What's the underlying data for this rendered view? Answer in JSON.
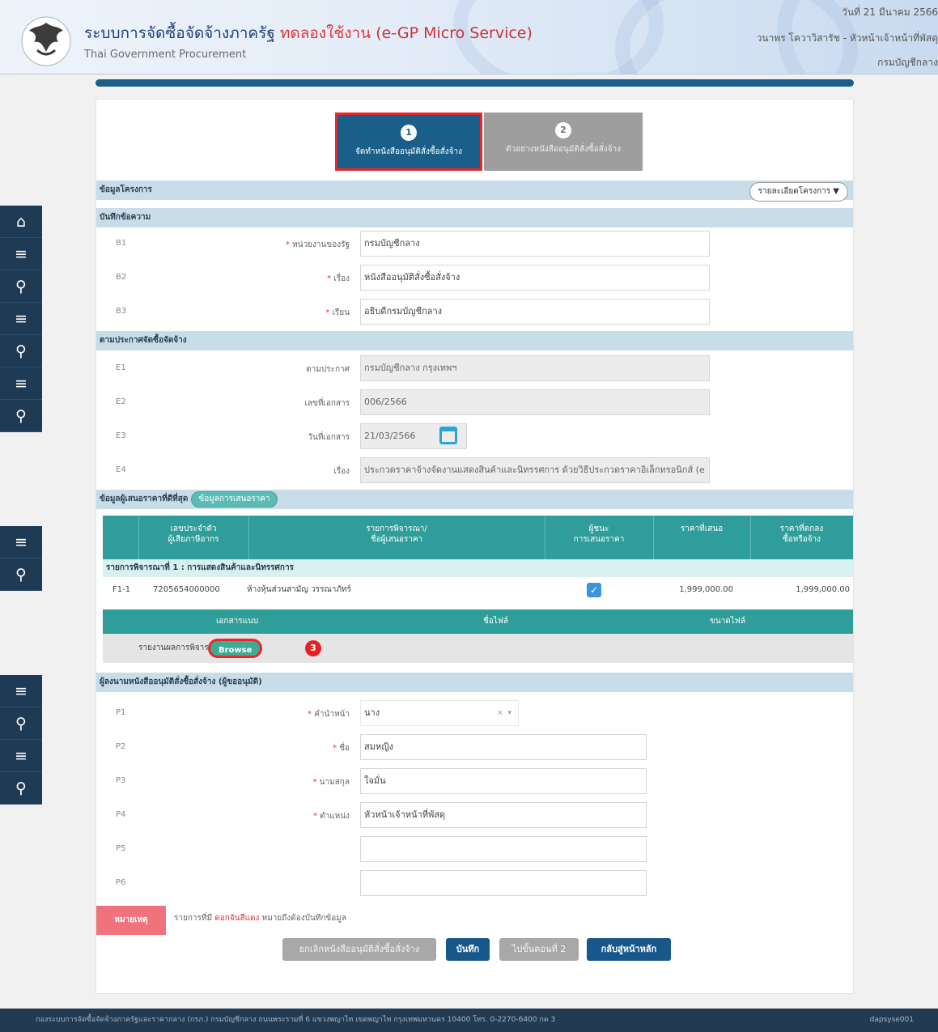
{
  "header": {
    "title_prefix": "ระบบการจัดซื้อจัดจ้างภาครัฐ ",
    "title_trial": "ทดลองใช้งาน",
    "title_suffix": " (e-GP Micro Service)",
    "subtitle": "Thai Government Procurement",
    "date": "วันที่ 21 มีนาคม 2566",
    "user": "วนาพร โควาวิสารัช - หัวหน้าเจ้าหน้าที่พัสดุ",
    "department": "กรมบัญชีกลาง"
  },
  "sidebar": {
    "home_icon": "home-icon",
    "menu_icon": "menu-icon",
    "search_icon": "search-icon"
  },
  "steps": [
    {
      "num": "1",
      "label": "จัดทำหนังสืออนุมัติสั่งซื้อสั่งจ้าง"
    },
    {
      "num": "2",
      "label": "ตัวอย่างหนังสืออนุมัติสั่งซื้อสั่งจ้าง"
    }
  ],
  "project": {
    "section": "ข้อมูลโครงการ",
    "detail_button": "รายละเอียดโครงการ ▼"
  },
  "memo": {
    "section": "บันทึกข้อความ",
    "rows": [
      {
        "id": "B1",
        "label": "หน่วยงานของรัฐ",
        "value": "กรมบัญชีกลาง"
      },
      {
        "id": "B2",
        "label": "เรื่อง",
        "value": "หนังสืออนุมัติสั่งซื้อสั่งจ้าง"
      },
      {
        "id": "B3",
        "label": "เรียน",
        "value": "อธิบดีกรมบัญชีกลาง"
      }
    ]
  },
  "announcement": {
    "section": "ตามประกาศจัดซื้อจัดจ้าง",
    "rows": [
      {
        "id": "E1",
        "label": "ตามประกาศ",
        "value": "กรมบัญชีกลาง กรุงเทพฯ"
      },
      {
        "id": "E2",
        "label": "เลขที่เอกสาร",
        "value": "006/2566"
      },
      {
        "id": "E3",
        "label": "วันที่เอกสาร",
        "value": "21/03/2566"
      },
      {
        "id": "E4",
        "label": "เรื่อง",
        "value": "ประกวดราคาจ้างจัดงานแสดงสินค้าและนิทรรศการ ด้วยวิธีประกวดราคาอิเล็กทรอนิกส์ (e"
      }
    ]
  },
  "bidder": {
    "section": "ข้อมูลผู้เสนอราคาที่ดีที่สุด",
    "pill": "ข้อมูลการเสนอราคา",
    "columns": {
      "tax_id": "เลขประจำตัว\nผู้เสียภาษีอากร",
      "item": "รายการพิจารณา/\nชื่อผู้เสนอราคา",
      "winner": "ผู้ชนะ\nการเสนอราคา",
      "offer": "ราคาที่เสนอ",
      "agreed": "ราคาที่ตกลง\nซื้อหรือจ้าง"
    },
    "category": "รายการพิจารณาที่ 1 : การแสดงสินค้าและนิทรรศการ",
    "row": {
      "id": "F1-1",
      "tax_id": "7205654000000",
      "name": "ห้างหุ้นส่วนสามัญ วรรณาภัทร์",
      "check": "✓",
      "offer": "1,999,000.00",
      "agreed": "1,999,000.00"
    }
  },
  "attachments": {
    "col_doc": "เอกสารแนบ",
    "col_file": "ชื่อไฟล์",
    "col_size": "ขนาดไฟล์",
    "row_label": "รายงานผลการพิจารณา",
    "browse": "Browse",
    "marker": "3"
  },
  "signer": {
    "section": "ผู้ลงนามหนังสืออนุมัติสั่งซื้อสั่งจ้าง (ผู้ขออนุมัติ)",
    "rows": [
      {
        "id": "P1",
        "label": "คำนำหน้า",
        "value": "นาง"
      },
      {
        "id": "P2",
        "label": "ชื่อ",
        "value": "สมหญิง"
      },
      {
        "id": "P3",
        "label": "นามสกุล",
        "value": "ใจมั่น"
      },
      {
        "id": "P4",
        "label": "ตำแหน่ง",
        "value": "หัวหน้าเจ้าหน้าที่พัสดุ"
      },
      {
        "id": "P5",
        "label": "",
        "value": ""
      },
      {
        "id": "P6",
        "label": "",
        "value": ""
      }
    ],
    "clear": "×",
    "caret": "▾"
  },
  "note": {
    "badge": "หมายเหตุ",
    "text_pre": "รายการที่มี ",
    "text_red": "ดอกจันสีแดง",
    "text_post": " หมายถึงต้องบันทึกข้อมูล"
  },
  "buttons": {
    "cancel": "ยกเลิกหนังสืออนุมัติสั่งซื้อสั่งจ้าง",
    "save": "บันทึก",
    "next": "ไปขั้นตอนที่ 2",
    "back": "กลับสู่หน้าหลัก"
  },
  "footer": {
    "text": "กองระบบการจัดซื้อจัดจ้างภาครัฐและราคากลาง (กรภ.) กรมบัญชีกลาง ถนนพระรามที่ 6 แขวงพญาไท เขตพญาไท กรุงเทพมหานคร 10400 โทร. 0-2270-6400 กด 3",
    "server": "dapsyse001"
  }
}
